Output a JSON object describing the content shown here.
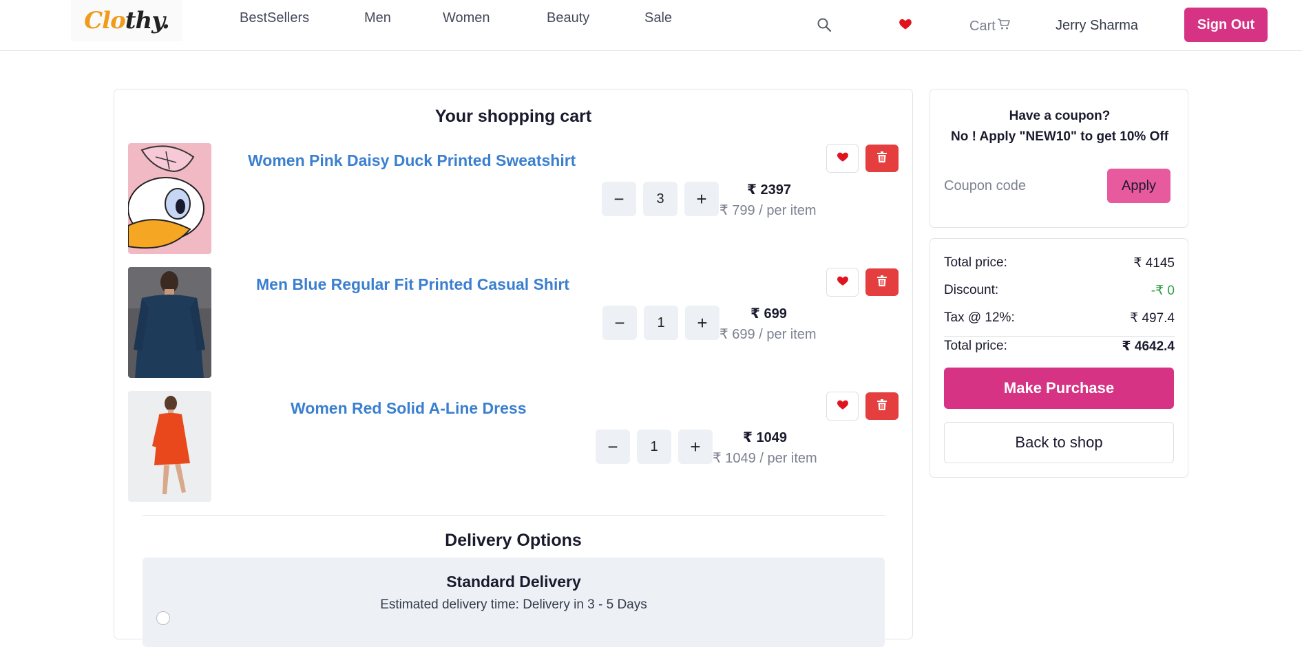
{
  "header": {
    "logo_part1": "Clo",
    "logo_part2": "thy.",
    "nav": [
      "BestSellers",
      "Men",
      "Women",
      "Beauty",
      "Sale"
    ],
    "icons": [
      "search-icon",
      "heart-icon",
      "cart-icon"
    ],
    "cart_label": "Cart",
    "user_name": "Jerry Sharma",
    "sign_out_label": "Sign Out"
  },
  "cart": {
    "title": "Your shopping cart",
    "items": [
      {
        "name": "Women Pink Daisy Duck Printed Sweatshirt",
        "quantity": "3",
        "total": "₹ 2397",
        "per_item": "₹ 799 / per item"
      },
      {
        "name": "Men Blue Regular Fit Printed Casual Shirt",
        "quantity": "1",
        "total": "₹ 699",
        "per_item": "₹ 699 / per item"
      },
      {
        "name": "Women Red Solid A-Line Dress",
        "quantity": "1",
        "total": "₹ 1049",
        "per_item": "₹ 1049 / per item"
      }
    ],
    "minus_symbol": "−",
    "plus_symbol": "+"
  },
  "delivery": {
    "title": "Delivery Options",
    "option_title": "Standard Delivery",
    "option_desc": "Estimated delivery time: Delivery in 3 - 5 Days"
  },
  "coupon": {
    "line1": "Have a coupon?",
    "line2": "No ! Apply \"NEW10\" to get 10% Off",
    "placeholder": "Coupon code",
    "value": "",
    "apply_label": "Apply"
  },
  "summary": {
    "total_label": "Total price:",
    "total_value": "₹ 4145",
    "discount_label": "Discount:",
    "discount_value": "-₹ 0",
    "tax_label": "Tax @ 12%:",
    "tax_value": "₹ 497.4",
    "grand_label": "Total price:",
    "grand_value": "₹ 4642.4",
    "purchase_label": "Make Purchase",
    "back_label": "Back to shop"
  },
  "colors": {
    "brand_pink": "#d63384",
    "apply_pink": "#e85a9e",
    "link_blue": "#3a7fd0",
    "delete_red": "#e53e3e",
    "discount_green": "#2f9e44"
  }
}
